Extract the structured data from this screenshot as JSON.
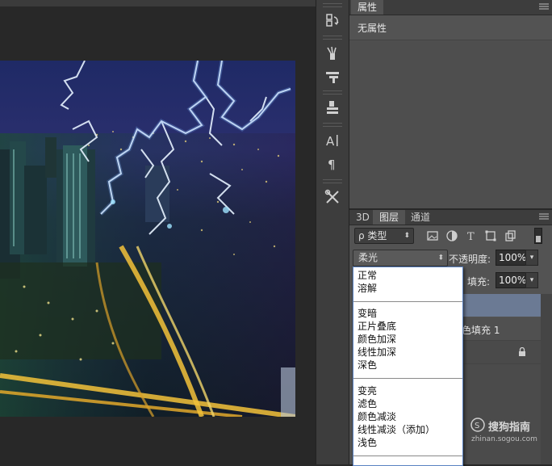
{
  "properties_panel": {
    "tab_label": "属性",
    "empty_text": "无属性"
  },
  "layers_panel": {
    "tabs": [
      {
        "label": "3D"
      },
      {
        "label": "图层"
      },
      {
        "label": "通道"
      }
    ],
    "filter_label": "ρ 类型",
    "blend_mode": "柔光",
    "opacity_label": "不透明度:",
    "opacity_value": "100%",
    "fill_label": "填充:",
    "fill_value": "100%",
    "layer_partial_name": "色填充 1"
  },
  "blend_menu": {
    "groups": [
      [
        "正常",
        "溶解"
      ],
      [
        "变暗",
        "正片叠底",
        "颜色加深",
        "线性加深",
        "深色"
      ],
      [
        "变亮",
        "滤色",
        "颜色减淡",
        "线性减淡（添加）",
        "浅色"
      ]
    ]
  },
  "watermark": {
    "brand": "搜狗指南",
    "url": "zhinan.sogou.com"
  },
  "colors": {
    "panel_bg": "#535353",
    "selected_layer": "#6b7a94",
    "dropdown_border": "#5a82c2"
  },
  "icons": [
    "rotate-icon",
    "brush-icon",
    "brush-settings-icon",
    "clone-source-icon",
    "character-icon",
    "paragraph-icon",
    "tools-icon",
    "lock-icon",
    "menu-icon"
  ]
}
